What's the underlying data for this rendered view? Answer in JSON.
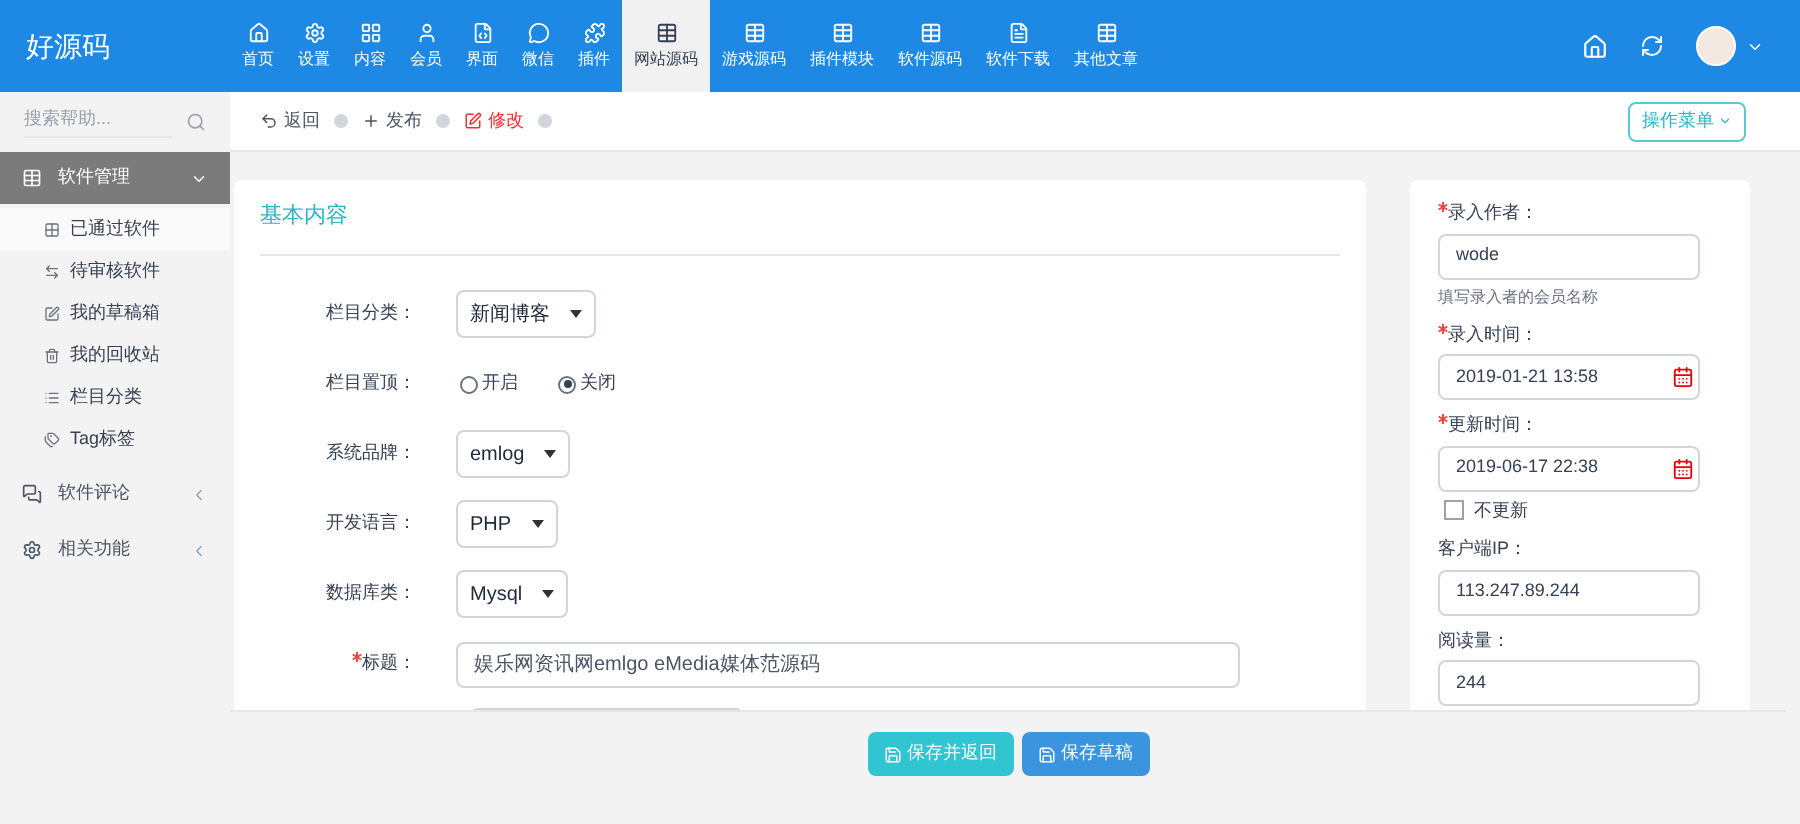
{
  "logo": "好源码",
  "nav": [
    {
      "label": "首页",
      "selected": false
    },
    {
      "label": "设置",
      "selected": false
    },
    {
      "label": "内容",
      "selected": false
    },
    {
      "label": "会员",
      "selected": false
    },
    {
      "label": "界面",
      "selected": false
    },
    {
      "label": "微信",
      "selected": false
    },
    {
      "label": "插件",
      "selected": false
    },
    {
      "label": "网站源码",
      "selected": true
    },
    {
      "label": "游戏源码",
      "selected": false
    },
    {
      "label": "插件模块",
      "selected": false
    },
    {
      "label": "软件源码",
      "selected": false
    },
    {
      "label": "软件下载",
      "selected": false
    },
    {
      "label": "其他文章",
      "selected": false
    }
  ],
  "search": {
    "placeholder": "搜索帮助..."
  },
  "sidebar": {
    "items": [
      {
        "label": "软件管理",
        "expanded": true,
        "children": [
          {
            "label": "已通过软件",
            "selected": true
          },
          {
            "label": "待审核软件",
            "selected": false
          },
          {
            "label": "我的草稿箱",
            "selected": false
          },
          {
            "label": "我的回收站",
            "selected": false
          },
          {
            "label": "栏目分类",
            "selected": false
          },
          {
            "label": "Tag标签",
            "selected": false
          }
        ]
      },
      {
        "label": "软件评论",
        "expanded": false
      },
      {
        "label": "相关功能",
        "expanded": false
      }
    ]
  },
  "breadcrumb": [
    {
      "label": "返回",
      "selected": false
    },
    {
      "label": "发布",
      "selected": false
    },
    {
      "label": "修改",
      "selected": true
    }
  ],
  "menu_button": "操作菜单",
  "main": {
    "title": "基本内容",
    "fields": [
      {
        "kind": "select",
        "label": "栏目分类：",
        "value": "新闻博客",
        "required": false
      },
      {
        "kind": "radio",
        "label": "栏目置顶：",
        "required": false,
        "options": [
          {
            "label": "开启",
            "selected": false
          },
          {
            "label": "关闭",
            "selected": true
          }
        ]
      },
      {
        "kind": "select",
        "label": "系统品牌：",
        "value": "emlog",
        "required": false
      },
      {
        "kind": "select",
        "label": "开发语言：",
        "value": "PHP",
        "required": false
      },
      {
        "kind": "select",
        "label": "数据库类：",
        "value": "Mysql",
        "required": false
      },
      {
        "kind": "text",
        "label": "标题：",
        "value": "娱乐网资讯网emlgo eMedia媒体范源码",
        "required": true
      }
    ]
  },
  "side": {
    "fields": [
      {
        "kind": "text",
        "label": "录入作者：",
        "value": "wode",
        "required": true,
        "hint": "填写录入者的会员名称"
      },
      {
        "kind": "date",
        "label": "录入时间：",
        "value": "2019-01-21 13:58",
        "required": true
      },
      {
        "kind": "date",
        "label": "更新时间：",
        "value": "2019-06-17 22:38",
        "required": true,
        "checkbox": {
          "label": "不更新",
          "checked": false
        }
      },
      {
        "kind": "text",
        "label": "客户端IP：",
        "value": "113.247.89.244",
        "required": false
      },
      {
        "kind": "text",
        "label": "阅读量：",
        "value": "244",
        "required": false
      }
    ]
  },
  "footer_buttons": [
    {
      "label": "保存并返回",
      "kind": "primary"
    },
    {
      "label": "保存草稿",
      "kind": "secondary"
    }
  ]
}
